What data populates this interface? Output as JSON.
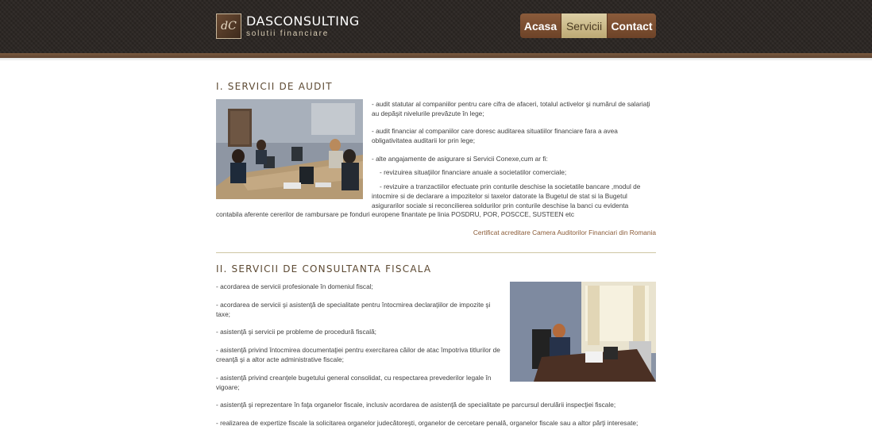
{
  "header": {
    "logo_mark": "dC",
    "brand_name": "DASCONSULTING",
    "tagline": "solutii financiare"
  },
  "nav": {
    "items": [
      {
        "label": "Acasa"
      },
      {
        "label": "Servicii"
      },
      {
        "label": "Contact"
      }
    ],
    "active_index": 1
  },
  "sections": {
    "audit": {
      "title": "I. SERVICII DE AUDIT",
      "p1": "- audit statutar al companiilor pentru care cifra de afaceri, totalul activelor şi numărul de salariaţi au depăşit nivelurile prevăzute în lege;",
      "p2": "- audit financiar al companiilor care doresc auditarea situatiilor financiare fara a avea obligativitatea auditarii lor prin lege;",
      "p3": "- alte angajamente de asigurare si Servicii Conexe,cum ar fi:",
      "p4": "- revizuirea situaţiilor financiare anuale a societatilor comerciale;",
      "p5_lead": "- revizuire a tranzactiilor efectuate prin conturile deschise la societatile bancare ,modul de intocmire si de declarare a impozitelor si taxelor datorate la Bugetul de stat si la Bugetul asigurarilor sociale si reconcilierea soldurilor prin conturile deschise la banci cu evidenta",
      "p5_tail": "contabila aferente cererilor de rambursare pe fonduri europene finantate pe linia POSDRU, POR, POSCCE, SUSTEEN etc",
      "cert_link": "Certificat acreditare Camera Auditorilor Financiari din Romania"
    },
    "fiscal": {
      "title": "II. SERVICII DE CONSULTANTA FISCALA",
      "items": [
        "- acordarea de servicii profesionale în domeniul fiscal;",
        "- acordarea de servicii şi asistenţă de specialitate pentru întocmirea declaraţiilor de impozite şi taxe;",
        "- asistenţă şi servicii pe probleme de procedură fiscală;",
        "- asistenţă privind întocmirea documentaţiei pentru exercitarea căilor de atac împotriva titlurilor de creanţă şi a altor acte administrative fiscale;",
        "- asistenţă privind creanţele bugetului general consolidat, cu respectarea prevederilor legale în vigoare;",
        "- asistenţă şi reprezentare în faţa organelor fiscale, inclusiv acordarea de asistenţă de specialitate pe parcursul derulării inspecţiei fiscale;",
        "- realizarea de expertize fiscale la solicitarea organelor judecătoreşti, organelor de cercetare penală, organelor fiscale sau a altor părţi interesate;"
      ]
    }
  },
  "colors": {
    "header_bg": "#2a2522",
    "nav_brown": "#7a4c30",
    "nav_active": "#cdbd8a",
    "section_title": "#5d4a33",
    "link": "#8a5a36"
  }
}
